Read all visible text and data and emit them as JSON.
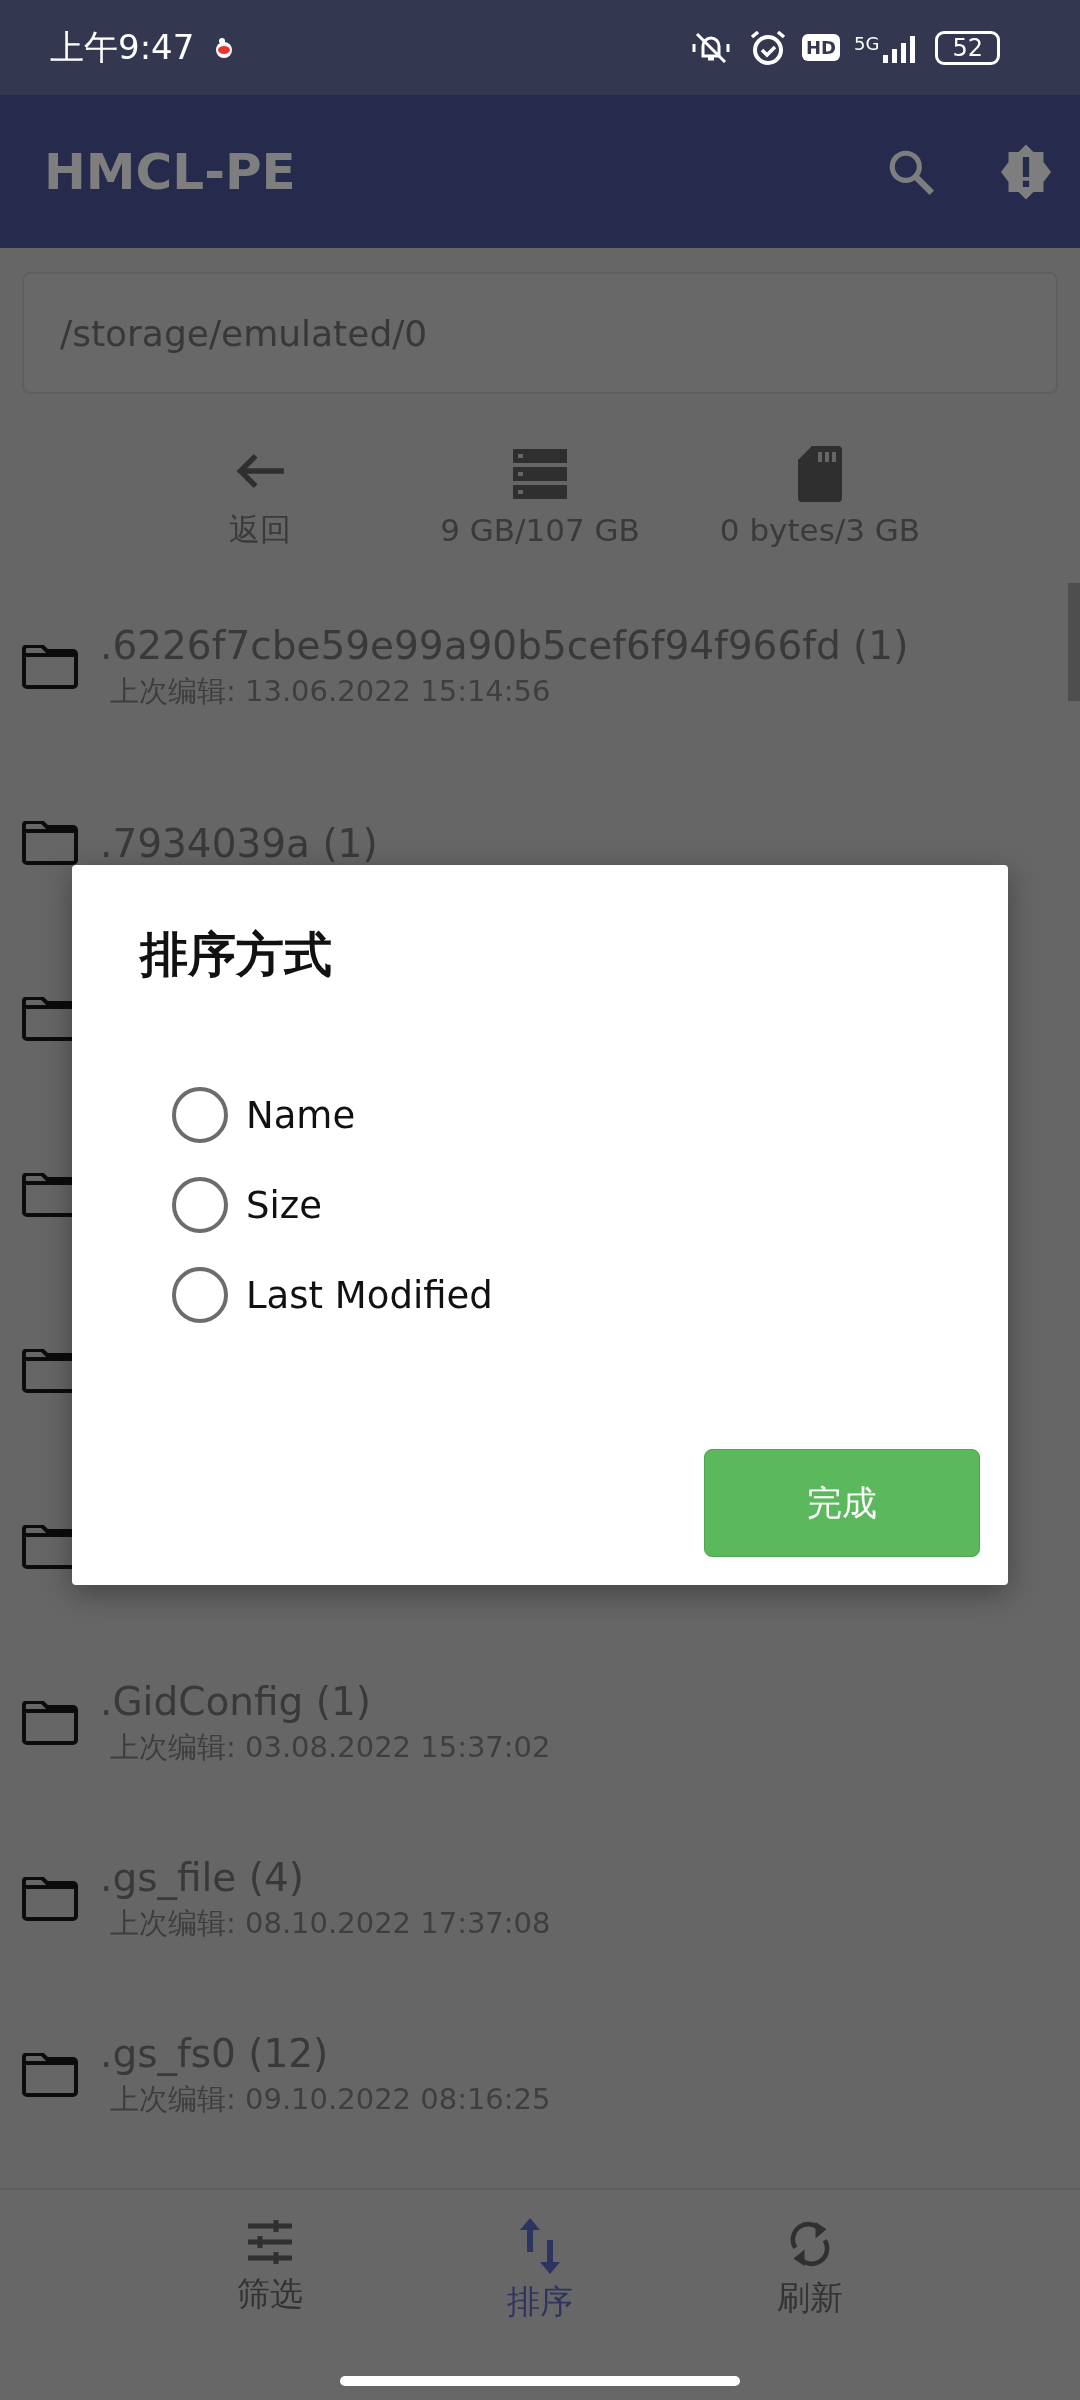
{
  "status_bar": {
    "time": "上午9:47",
    "network": "5G",
    "hd": "HD",
    "battery": "52"
  },
  "app_bar": {
    "title": "HMCL-PE"
  },
  "path_field": {
    "value": "/storage/emulated/0"
  },
  "toolbar": [
    {
      "kind": "back",
      "label": "返回"
    },
    {
      "kind": "storage",
      "label": "9 GB/107 GB"
    },
    {
      "kind": "sdcard",
      "label": "0 bytes/3 GB"
    }
  ],
  "files": [
    {
      "kind": "folder",
      "name": ".6226f7cbe59e99a90b5cef6f94f966fd (1)",
      "modified": "上次编辑: 13.06.2022 15:14:56"
    },
    {
      "kind": "folder",
      "name": ".7934039a (1)"
    },
    {
      "kind": "folder"
    },
    {
      "kind": "folder"
    },
    {
      "kind": "folder"
    },
    {
      "kind": "folder"
    },
    {
      "kind": "folder",
      "name": ".GidConfig (1)",
      "modified": "上次编辑: 03.08.2022 15:37:02"
    },
    {
      "kind": "folder",
      "name": ".gs_file (4)",
      "modified": "上次编辑: 08.10.2022 17:37:08"
    },
    {
      "kind": "folder",
      "name": ".gs_fs0 (12)",
      "modified": "上次编辑: 09.10.2022 08:16:25"
    }
  ],
  "bottom_nav": [
    {
      "kind": "filter",
      "label": "筛选",
      "selected": false
    },
    {
      "kind": "sort",
      "label": "排序",
      "selected": true
    },
    {
      "kind": "refresh",
      "label": "刷新",
      "selected": false
    }
  ],
  "dialog": {
    "title": "排序方式",
    "options": [
      {
        "label": "Name",
        "selected": false
      },
      {
        "label": "Size",
        "selected": false
      },
      {
        "label": "Last Modified",
        "selected": false
      }
    ],
    "button": "完成"
  }
}
